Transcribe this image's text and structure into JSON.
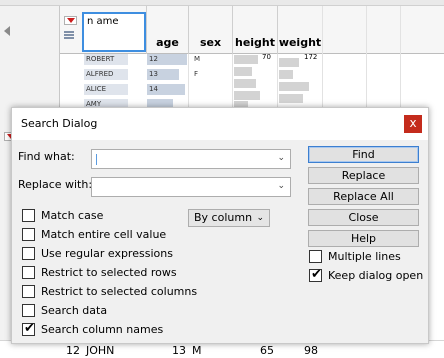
{
  "table": {
    "first_column_header": "n ame",
    "column_headers": [
      "age",
      "sex",
      "height",
      "weight"
    ],
    "rows": [
      {
        "name": "ROBERT",
        "age": "12",
        "sex": "M",
        "height": "70",
        "weight": "172"
      },
      {
        "name": "ALFRED",
        "age": "13",
        "sex": "F",
        "height": "",
        "weight": ""
      },
      {
        "name": "ALICE",
        "age": "14",
        "sex": "",
        "height": "",
        "weight": ""
      },
      {
        "name": "AMY",
        "age": "",
        "sex": "",
        "height": "",
        "weight": ""
      }
    ],
    "bottom_row": {
      "row_num": "12",
      "name": "JOHN",
      "age": "13",
      "sex": "M",
      "height": "65",
      "weight": "98"
    }
  },
  "dialog": {
    "title": "Search Dialog",
    "close_glyph": "x",
    "find_label": "Find what:",
    "find_value": "",
    "replace_label": "Replace with:",
    "replace_value": "",
    "scope_dropdown": "By column",
    "buttons": {
      "find": "Find",
      "replace": "Replace",
      "replace_all": "Replace All",
      "close": "Close",
      "help": "Help"
    },
    "options": [
      {
        "label": "Match case",
        "checked": false
      },
      {
        "label": "Match entire cell value",
        "checked": false
      },
      {
        "label": "Use regular expressions",
        "checked": false
      },
      {
        "label": "Restrict to selected rows",
        "checked": false
      },
      {
        "label": "Restrict to selected columns",
        "checked": false
      },
      {
        "label": "Search data",
        "checked": false
      },
      {
        "label": "Search column names",
        "checked": true
      }
    ],
    "right_options": [
      {
        "label": "Multiple lines",
        "checked": false
      },
      {
        "label": "Keep dialog open",
        "checked": true
      }
    ]
  }
}
